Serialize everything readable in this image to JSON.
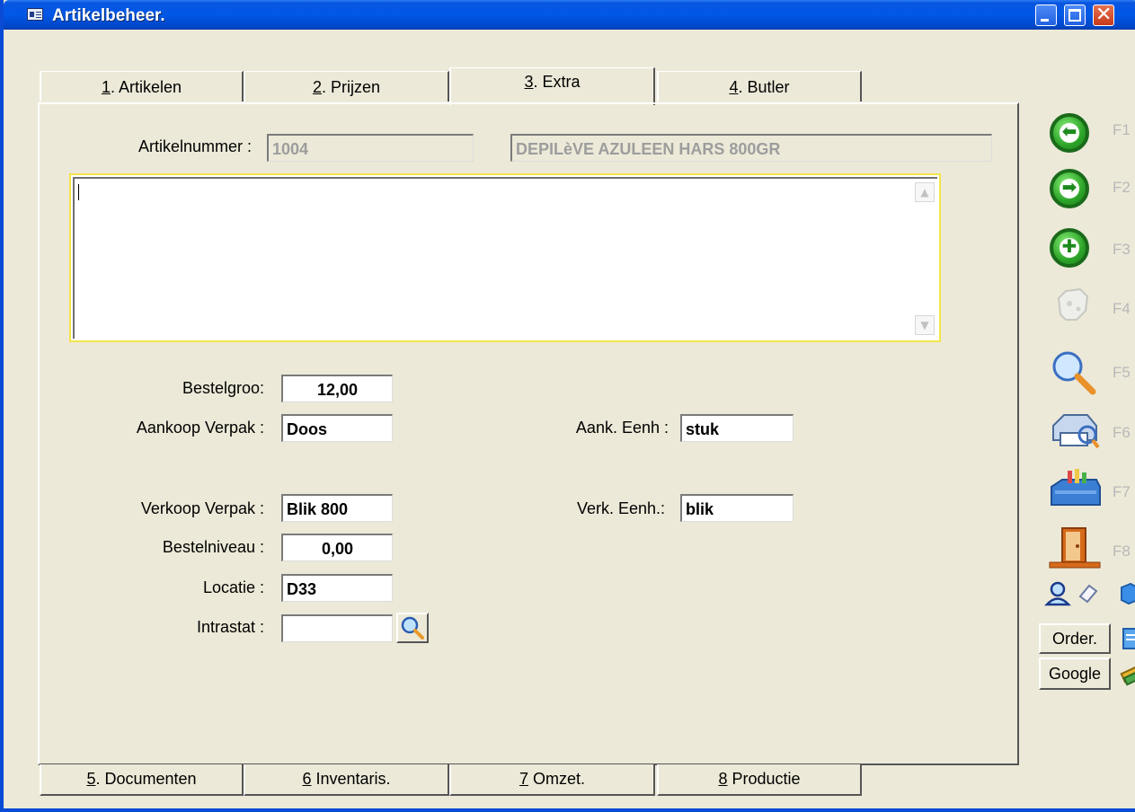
{
  "window": {
    "title": "Artikelbeheer."
  },
  "tabs_top": [
    {
      "key": "1",
      "label": ". Artikelen"
    },
    {
      "key": "2",
      "label": ". Prijzen"
    },
    {
      "key": "3",
      "label": ". Extra"
    },
    {
      "key": "4",
      "label": ". Butler"
    }
  ],
  "tabs_bottom": [
    {
      "key": "5",
      "label": ". Documenten"
    },
    {
      "key": "6",
      "label": " Inventaris."
    },
    {
      "key": "7",
      "label": " Omzet."
    },
    {
      "key": "8",
      "label": " Productie"
    }
  ],
  "form": {
    "artikelnummer_label": "Artikelnummer :",
    "artikelnummer": "1004",
    "omschrijving": "DEPILèVE AZULEEN HARS 800GR",
    "memo": "",
    "bestelgroo_label": "Bestelgroo:",
    "bestelgroo": "12,00",
    "aankoop_verpak_label": "Aankoop Verpak :",
    "aankoop_verpak": "Doos",
    "aank_eenh_label": "Aank. Eenh :",
    "aank_eenh": "stuk",
    "verkoop_verpak_label": "Verkoop Verpak :",
    "verkoop_verpak": "Blik 800",
    "verk_eenh_label": "Verk. Eenh.:",
    "verk_eenh": "blik",
    "bestelniveau_label": "Bestelniveau :",
    "bestelniveau": "0,00",
    "locatie_label": "Locatie :",
    "locatie": "D33",
    "intrastat_label": "Intrastat :",
    "intrastat": ""
  },
  "toolbar": {
    "f1": "F1",
    "f2": "F2",
    "f3": "F3",
    "f4": "F4",
    "f5": "F5",
    "f6": "F6",
    "f7": "F7",
    "f8": "F8",
    "order_label": "Order.",
    "google_label": "Google"
  },
  "colors": {
    "title_blue": "#0058e6",
    "face": "#ece9d8",
    "focus_border": "#f3e54a",
    "green_icon": "#2ca428"
  }
}
